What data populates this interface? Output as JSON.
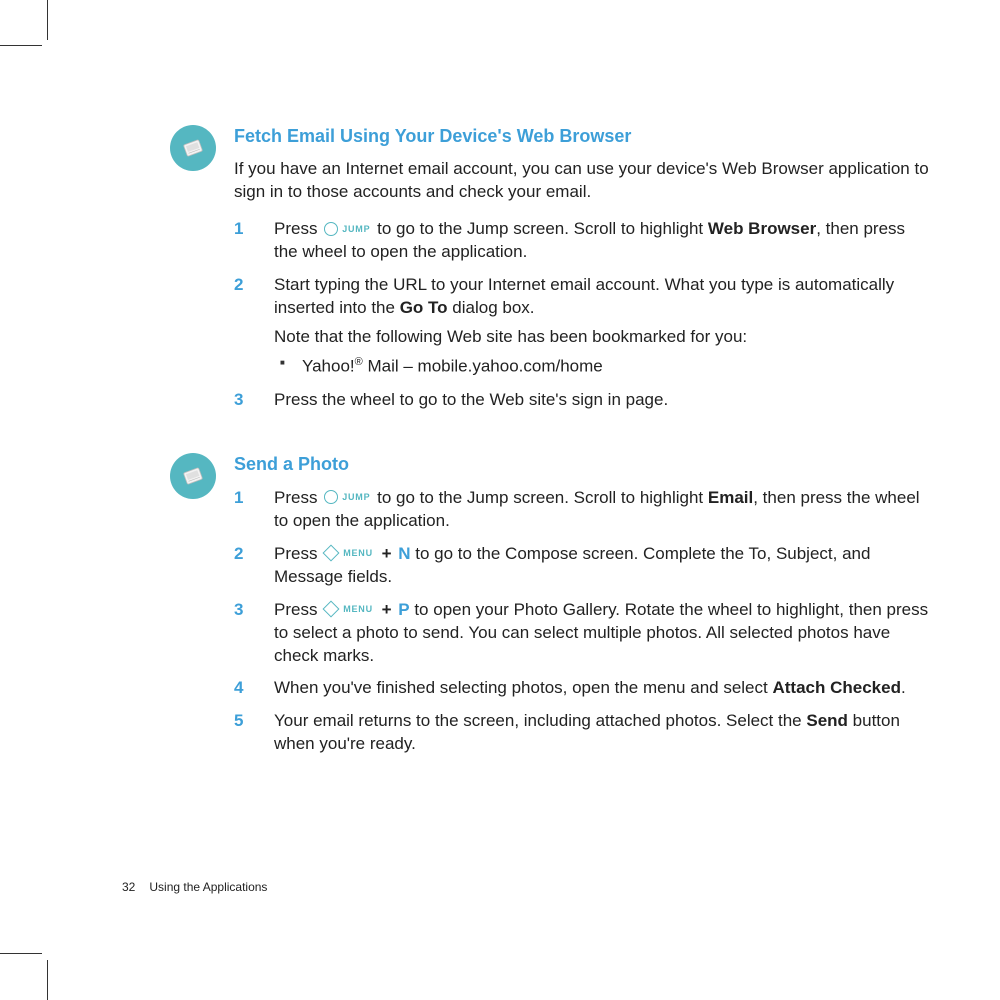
{
  "footer": {
    "page_number": "32",
    "chapter": "Using the Applications"
  },
  "icons": {
    "jump_label": "JUMP",
    "menu_label": "MENU"
  },
  "section1": {
    "title": "Fetch Email Using Your Device's Web Browser",
    "intro": "If you have an Internet email account, you can use your device's Web Browser application to sign in to those accounts and check your email.",
    "steps": {
      "s1": {
        "a": "Press ",
        "b": " to go to the Jump screen. Scroll to highlight ",
        "bold": "Web Browser",
        "c": ", then press the wheel to open the application."
      },
      "s2": {
        "a": "Start typing the URL to your Internet email account. What you type is automatically inserted into the ",
        "bold": "Go To",
        "b": " dialog box.",
        "note": "Note that the following Web site has been bookmarked for you:",
        "bullet_a": "Yahoo!",
        "bullet_reg": "®",
        "bullet_b": " Mail – mobile.yahoo.com/home"
      },
      "s3": {
        "a": "Press the wheel to go to the Web site's sign in page."
      }
    }
  },
  "section2": {
    "title": "Send a Photo",
    "steps": {
      "s1": {
        "a": "Press ",
        "b": " to go to the Jump screen. Scroll to highlight ",
        "bold": "Email",
        "c": ", then press the wheel to open the application."
      },
      "s2": {
        "a": "Press ",
        "plus": " + ",
        "hotkey": "N",
        "b": " to go to the Compose screen. Complete the To, Subject, and Message fields."
      },
      "s3": {
        "a": "Press ",
        "plus": " + ",
        "hotkey": "P",
        "b": " to open your Photo Gallery. Rotate the wheel to highlight, then press to select a photo to send. You can select multiple photos. All selected photos have check marks."
      },
      "s4": {
        "a": "When you've finished selecting photos, open the menu and select ",
        "bold": "Attach Checked",
        "b": "."
      },
      "s5": {
        "a": "Your email returns to the screen, including attached photos. Select the ",
        "bold": "Send",
        "b": " button when you're ready."
      }
    }
  }
}
